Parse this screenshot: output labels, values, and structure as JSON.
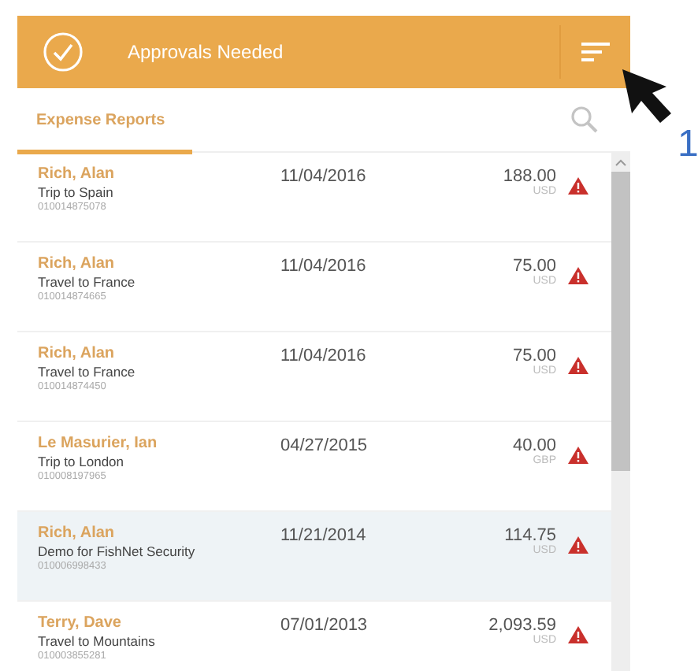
{
  "header": {
    "title": "Approvals Needed"
  },
  "tabs": [
    {
      "label": "Expense Reports",
      "selected": true
    }
  ],
  "reports": [
    {
      "name": "Rich, Alan",
      "title": "Trip to Spain",
      "id": "010014875078",
      "date": "11/04/2016",
      "amount": "188.00",
      "currency": "USD",
      "warning": true,
      "selected": false
    },
    {
      "name": "Rich, Alan",
      "title": "Travel to France",
      "id": "010014874665",
      "date": "11/04/2016",
      "amount": "75.00",
      "currency": "USD",
      "warning": true,
      "selected": false
    },
    {
      "name": "Rich, Alan",
      "title": "Travel to France",
      "id": "010014874450",
      "date": "11/04/2016",
      "amount": "75.00",
      "currency": "USD",
      "warning": true,
      "selected": false
    },
    {
      "name": "Le Masurier, Ian",
      "title": "Trip to London",
      "id": "010008197965",
      "date": "04/27/2015",
      "amount": "40.00",
      "currency": "GBP",
      "warning": true,
      "selected": false
    },
    {
      "name": "Rich, Alan",
      "title": "Demo for FishNet Security",
      "id": "010006998433",
      "date": "11/21/2014",
      "amount": "114.75",
      "currency": "USD",
      "warning": true,
      "selected": true
    },
    {
      "name": "Terry, Dave",
      "title": "Travel to Mountains",
      "id": "010003855281",
      "date": "07/01/2013",
      "amount": "2,093.59",
      "currency": "USD",
      "warning": true,
      "selected": false
    }
  ],
  "annotation": {
    "label": "1"
  }
}
